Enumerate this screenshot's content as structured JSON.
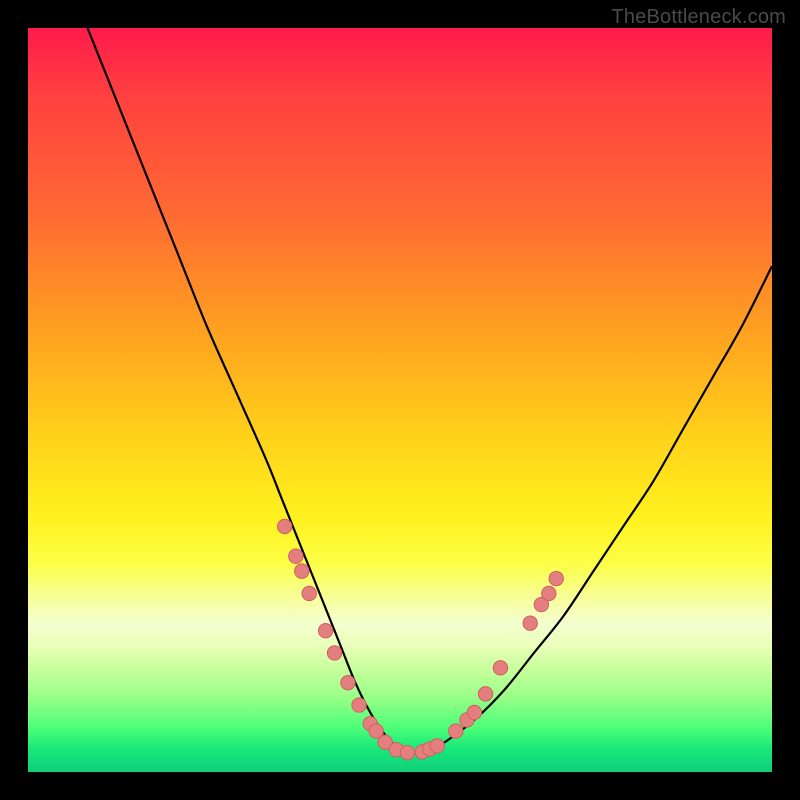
{
  "watermark": "TheBottleneck.com",
  "colors": {
    "curve": "#000000",
    "marker_fill": "#e37f7f",
    "marker_stroke": "#d45f5f",
    "background_top": "#ff1a4b",
    "background_bottom": "#0fce7a",
    "frame": "#000000"
  },
  "chart_data": {
    "type": "line",
    "title": "",
    "xlabel": "",
    "ylabel": "",
    "xlim": [
      0,
      100
    ],
    "ylim": [
      0,
      100
    ],
    "grid": false,
    "legend": false,
    "description": "V-shaped bottleneck curve on a rainbow gradient. Left branch descends steeply from top-left, flattens near the bottom center, then rises toward the right edge. Salmon-colored bead markers cluster low on both branches.",
    "series": [
      {
        "name": "bottleneck-curve",
        "x": [
          8,
          12,
          16,
          20,
          24,
          28,
          32,
          34,
          36,
          38,
          40,
          42,
          44,
          46,
          48,
          50,
          52,
          54,
          56,
          60,
          64,
          68,
          72,
          76,
          80,
          84,
          88,
          92,
          96,
          100
        ],
        "y": [
          100,
          90,
          80,
          70,
          60,
          51,
          42,
          37,
          32,
          27,
          22,
          17,
          12,
          8,
          5,
          3,
          2.5,
          3,
          4,
          7,
          11,
          16,
          21,
          27,
          33,
          39,
          46,
          53,
          60,
          68
        ]
      }
    ],
    "markers": {
      "note": "Salmon round markers scattered near the bottom of the V on both branches.",
      "points": [
        {
          "x": 34.5,
          "y": 33
        },
        {
          "x": 36.0,
          "y": 29
        },
        {
          "x": 36.8,
          "y": 27
        },
        {
          "x": 37.8,
          "y": 24
        },
        {
          "x": 40.0,
          "y": 19
        },
        {
          "x": 41.2,
          "y": 16
        },
        {
          "x": 43.0,
          "y": 12
        },
        {
          "x": 44.5,
          "y": 9
        },
        {
          "x": 46.0,
          "y": 6.5
        },
        {
          "x": 46.8,
          "y": 5.5
        },
        {
          "x": 48.0,
          "y": 4
        },
        {
          "x": 49.5,
          "y": 3
        },
        {
          "x": 51.0,
          "y": 2.6
        },
        {
          "x": 53.0,
          "y": 2.7
        },
        {
          "x": 54.0,
          "y": 3.1
        },
        {
          "x": 55.0,
          "y": 3.5
        },
        {
          "x": 57.5,
          "y": 5.5
        },
        {
          "x": 59.0,
          "y": 7
        },
        {
          "x": 60.0,
          "y": 8
        },
        {
          "x": 61.5,
          "y": 10.5
        },
        {
          "x": 63.5,
          "y": 14
        },
        {
          "x": 67.5,
          "y": 20
        },
        {
          "x": 69.0,
          "y": 22.5
        },
        {
          "x": 70.0,
          "y": 24
        },
        {
          "x": 71.0,
          "y": 26
        }
      ]
    }
  }
}
